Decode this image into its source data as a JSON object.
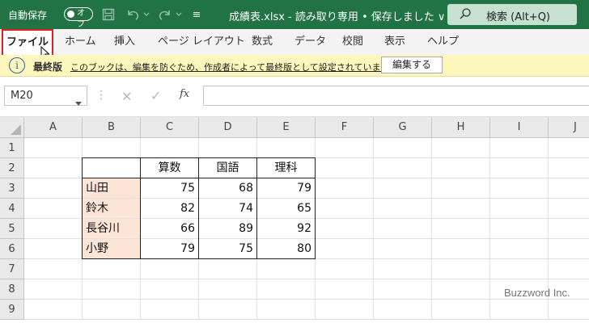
{
  "titlebar": {
    "autosave_label": "自動保存",
    "autosave_state": "オフ",
    "document_title": "成績表.xlsx  -  読み取り専用 • 保存しました ∨",
    "search_placeholder": "検索 (Alt+Q)",
    "qat_customize_glyph": "≡",
    "colors": {
      "background": "#217346",
      "search_bg": "#c6e0d1"
    }
  },
  "ribbon": {
    "tabs": [
      {
        "label": "ファイル",
        "selected": true
      },
      {
        "label": "ホーム"
      },
      {
        "label": "挿入"
      },
      {
        "label": "ページ レイアウト"
      },
      {
        "label": "数式"
      },
      {
        "label": "データ"
      },
      {
        "label": "校閲"
      },
      {
        "label": "表示"
      },
      {
        "label": "ヘルプ"
      }
    ]
  },
  "message_bar": {
    "icon": "info-icon",
    "icon_glyph": "i",
    "title": "最終版",
    "text": "このブックは、編集を防ぐため、作成者によって最終版として設定されています。",
    "button_label": "編集する",
    "colors": {
      "background": "#fdf6bd"
    }
  },
  "formula_bar": {
    "name_box": "M20",
    "cancel_glyph": "✕",
    "enter_glyph": "✓",
    "fx_label": "fx",
    "formula": "",
    "separator_glyph": "⋮"
  },
  "sheet": {
    "columns": [
      "A",
      "B",
      "C",
      "D",
      "E",
      "F",
      "G",
      "H",
      "I",
      "J"
    ],
    "rows": [
      "1",
      "2",
      "3",
      "4",
      "5",
      "6",
      "7",
      "8",
      "9"
    ],
    "headers": [
      "算数",
      "国語",
      "理科"
    ],
    "records": [
      {
        "name": "山田",
        "scores": [
          "75",
          "68",
          "79"
        ]
      },
      {
        "name": "鈴木",
        "scores": [
          "82",
          "74",
          "65"
        ]
      },
      {
        "name": "長谷川",
        "scores": [
          "66",
          "89",
          "92"
        ]
      },
      {
        "name": "小野",
        "scores": [
          "79",
          "75",
          "80"
        ]
      }
    ],
    "colors": {
      "name_fill": "#fce4d6"
    }
  },
  "watermark": "Buzzword Inc."
}
